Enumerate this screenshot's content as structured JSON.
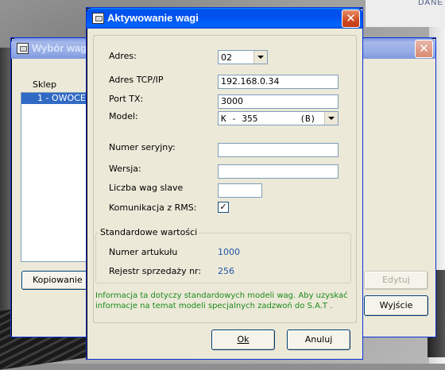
{
  "desktop": {
    "corner_text": "DANE"
  },
  "back_window": {
    "title": "Wybór wag",
    "list_label": "Sklep",
    "list_items": [
      "1 - OWOCE"
    ],
    "btn_copy": "Kopiowanie sk",
    "btn_edit": "Edytuj",
    "btn_exit": "Wyjście"
  },
  "dialog": {
    "title": "Aktywowanie wagi",
    "fields": {
      "adres_label": "Adres:",
      "adres_value": "02",
      "tcp_label": "Adres TCP/IP",
      "tcp_value": "192.168.0.34",
      "port_label": "Port TX:",
      "port_value": "3000",
      "model_label": "Model:",
      "model_value": "K - 355        (B)",
      "serial_label": "Numer seryjny:",
      "serial_value": "",
      "version_label": "Wersja:",
      "version_value": "",
      "slave_label": "Liczba wag slave",
      "slave_value": "",
      "rms_label": "Komunikacja z  RMS:",
      "rms_checked": true
    },
    "defaults": {
      "group_title": "Standardowe wartości",
      "article_label": "Numer artukułu",
      "article_value": "1000",
      "sales_label": "Rejestr sprzedaży nr:",
      "sales_value": "256"
    },
    "info_line1": "Informacja ta dotyczy standardowych modeli wag. Aby uzyskać",
    "info_line2": "informacje na temat modeli specjalnych zadzwoń do  S.A.T .",
    "ok_label": "Ok",
    "cancel_label": "Anuluj"
  }
}
